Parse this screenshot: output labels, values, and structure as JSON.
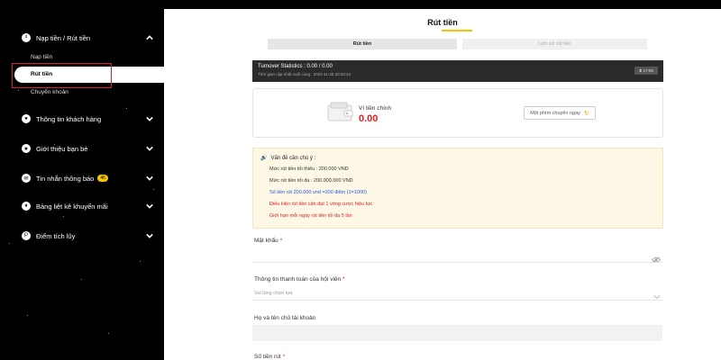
{
  "sidebar": {
    "deposit_withdraw": "Nạp tiền / Rút tiền",
    "deposit": "Nạp tiền",
    "withdraw": "Rút tiền",
    "transfer": "Chuyển khoản",
    "customer_info": "Thông tin khách hàng",
    "refer_friends": "Giới thiệu bạn bè",
    "notifications": "Tin nhắn thông báo",
    "notifications_badge": "46",
    "promotions": "Bảng liệt kê khuyến mãi",
    "points": "Điểm tích lũy"
  },
  "main": {
    "title": "Rút tiền",
    "tab_withdraw": "Rút tiền",
    "tab_history": "Lịch sử rút tiền",
    "turnover_stats": "Turnover Statistics : 0.00 / 0.00",
    "turnover_updated": "Thời gian cập nhật cuối cùng : 2024-11-26 20:02:24",
    "turnover_time": "17:06",
    "wallet_label": "Ví tiền chính",
    "wallet_amount": "0.00",
    "transfer_button": "Một phím chuyển ngay"
  },
  "notice": {
    "title": "Vấn đề cần chú ý :",
    "min": "Mức rút tiền tối thiểu : 200.000 VND",
    "max": "Mức rút tiền tối đa : 200.000.000 VND",
    "points": "Số tiền rút 200.000 vnd =200 điểm (1=1000)",
    "condition": "Điều kiện rút tiền cần đạt 1 vòng cược hiệu lực",
    "limit": "Giới hạn mỗi ngày rút tiền tối đa 5 lần"
  },
  "form": {
    "password_label": "Mật khẩu",
    "payment_label": "Thông tin thanh toán của hội viên",
    "payment_placeholder": "Vui lòng chọn lựa",
    "account_name_label": "Họ và tên chủ tài khoản",
    "amount_label": "Số tiền rút"
  },
  "colors": {
    "accent": "#f5c400",
    "danger": "#e02020",
    "link": "#2255dd"
  }
}
